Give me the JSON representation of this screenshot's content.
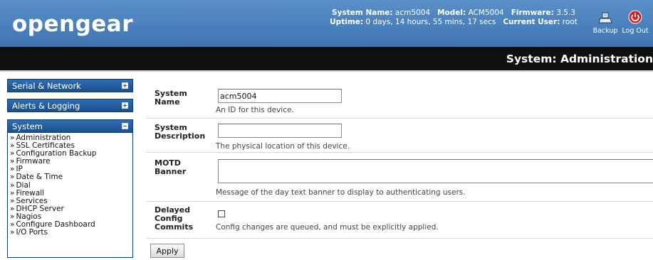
{
  "header": {
    "logo": "opengear",
    "sysinfo": {
      "system_name_label": "System Name:",
      "system_name": "acm5004",
      "model_label": "Model:",
      "model": "ACM5004",
      "firmware_label": "Firmware:",
      "firmware": "3.5.3",
      "uptime_label": "Uptime:",
      "uptime": "0 days, 14 hours, 55 mins, 17 secs",
      "user_label": "Current User:",
      "user": "root"
    },
    "backup_label": "Backup",
    "logout_label": "Log Out"
  },
  "page_title": "System: Administration",
  "sidebar": {
    "sections": [
      {
        "label": "Serial & Network",
        "expanded": false
      },
      {
        "label": "Alerts & Logging",
        "expanded": false
      },
      {
        "label": "System",
        "expanded": true
      }
    ],
    "system_items": [
      "Administration",
      "SSL Certificates",
      "Configuration Backup",
      "Firmware",
      "IP",
      "Date & Time",
      "Dial",
      "Firewall",
      "Services",
      "DHCP Server",
      "Nagios",
      "Configure Dashboard",
      "I/O Ports"
    ]
  },
  "form": {
    "system_name": {
      "label_line1": "System",
      "label_line2": "Name",
      "value": "acm5004",
      "help": "An ID for this device."
    },
    "system_description": {
      "label_line1": "System",
      "label_line2": "Description",
      "value": "",
      "help": "The physical location of this device."
    },
    "motd_banner": {
      "label_line1": "MOTD",
      "label_line2": "Banner",
      "value": "",
      "help": "Message of the day text banner to display to authenticating users."
    },
    "delayed_config": {
      "label_line1": "Delayed",
      "label_line2": "Config",
      "label_line3": "Commits",
      "checked": false,
      "help": "Config changes are queued, and must be explicitly applied."
    },
    "apply_label": "Apply"
  },
  "colors": {
    "header_blue": "#4d83be",
    "title_bar": "#101010",
    "menu_blue": "#1c4f8e",
    "logout_red": "#d42020"
  },
  "icons": {
    "backup": "backup-tray-icon",
    "logout": "power-icon",
    "collapsed": "plus-box-icon",
    "expanded": "minus-box-icon"
  }
}
